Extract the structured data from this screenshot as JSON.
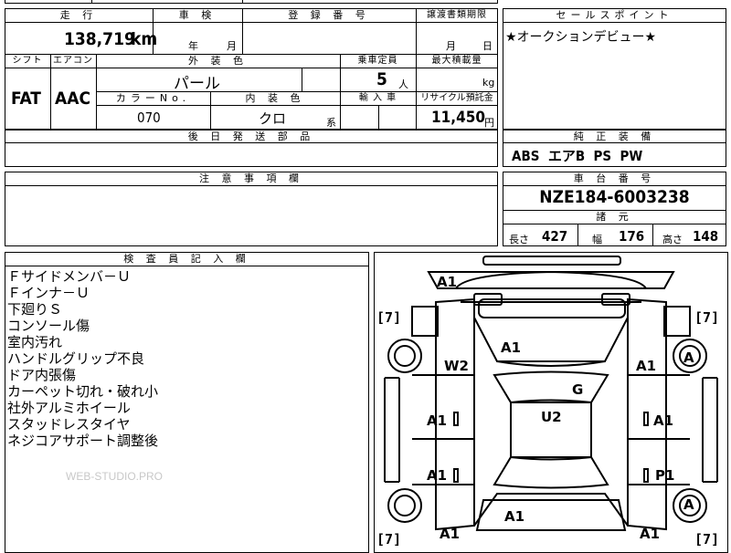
{
  "top_headers": {
    "mileage": "走 行",
    "inspection": "車 検",
    "registration": "登 録 番 号",
    "transfer_deadline": "譲渡書類期限",
    "sales_point": "セールスポイント"
  },
  "mileage": {
    "value": "138,719",
    "unit": "km"
  },
  "inspection": {
    "year_label": "年",
    "month_label": "月"
  },
  "transfer": {
    "month_label": "月",
    "day_label": "日"
  },
  "sales_point_text": "★オークションデビュー★",
  "row2_headers": {
    "shift": "シフト",
    "aircon": "エアコン",
    "exterior_color": "外 装 色",
    "capacity": "乗車定員",
    "max_load": "最大積載量"
  },
  "shift": "FAT",
  "aircon": "AAC",
  "exterior_color": "パール",
  "capacity": {
    "value": "5",
    "unit": "人"
  },
  "max_load_unit": "kg",
  "row3_headers": {
    "color_no": "カラーNo.",
    "interior_color": "内 装 色",
    "import": "輸 入 車",
    "recycle": "リサイクル預託金"
  },
  "color_no": "070",
  "interior_color": {
    "value": "クロ",
    "suffix": "系"
  },
  "recycle": {
    "value": "11,450",
    "unit": "円"
  },
  "later_parts_header": "後 日 発 送 部 品",
  "genuine_equipment_header": "純 正 装 備",
  "genuine_equipment": "ABS  エアB  PS  PW",
  "caution_header": "注 意 事 項 欄",
  "chassis_header": "車 台 番 号",
  "chassis_number": "NZE184-6003238",
  "specs_header": "諸 元",
  "specs": {
    "length_label": "長さ",
    "length": "427",
    "width_label": "幅",
    "width": "176",
    "height_label": "高さ",
    "height": "148"
  },
  "inspector_header": "検 査 員 記 入 欄",
  "inspector_notes": [
    "Ｆサイドメンバ－Ｕ",
    "Ｆインナ－Ｕ",
    "下廻りＳ",
    "コンソール傷",
    "室内汚れ",
    "ハンドルグリップ不良",
    "ドア内張傷",
    "カーペット切れ・破れ小",
    "社外アルミホイール",
    "スタッドレスタイヤ",
    "ネジコアサポート調整後"
  ],
  "watermark": "WEB-STUDIO.PRO",
  "diagram": {
    "front_bumper": "A1",
    "hood": "A1",
    "left_front_fender": "W2",
    "right_front_fender": "A1",
    "roof": "G",
    "windshield_area": "U2",
    "left_front_door": "A1",
    "right_front_door": "A1",
    "left_rear_door": "A1",
    "right_rear_door": "P1",
    "trunk": "A1",
    "left_rear_quarter": "A1",
    "right_rear_quarter": "A1",
    "right_front_tire": "A",
    "right_rear_tire": "A",
    "tire_tread": "7",
    "bracket_left": "[",
    "bracket_right": "]"
  }
}
